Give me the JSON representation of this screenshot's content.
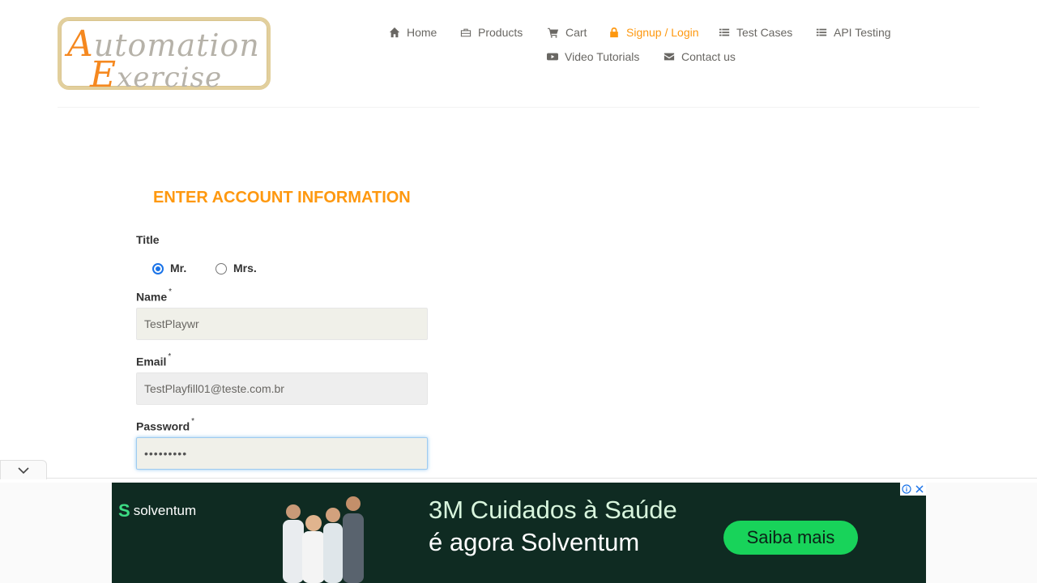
{
  "logo": {
    "line1_cap": "A",
    "line1_rest": "utomation",
    "line2_cap": "E",
    "line2_rest": "xercise"
  },
  "nav": {
    "home": "Home",
    "products": "Products",
    "cart": "Cart",
    "signup_login": "Signup / Login",
    "test_cases": "Test Cases",
    "api_testing": "API Testing",
    "video_tutorials": "Video Tutorials",
    "contact_us": "Contact us"
  },
  "form": {
    "title": "ENTER ACCOUNT INFORMATION",
    "title_label": "Title",
    "title_options": [
      {
        "label": "Mr.",
        "selected": true
      },
      {
        "label": "Mrs.",
        "selected": false
      }
    ],
    "name_label": "Name",
    "name_value": "TestPlaywr",
    "email_label": "Email",
    "email_value": "TestPlayfill01@teste.com.br",
    "password_label": "Password",
    "password_value": "•••••••••",
    "required_mark": "*"
  },
  "ad": {
    "brand": "solventum",
    "headline1": "3M Cuidados à Saúde",
    "headline2": "é agora Solventum",
    "cta": "Saiba mais"
  },
  "colors": {
    "accent": "#fe980f",
    "ad_bg": "#0f2b22",
    "ad_cta": "#18d35a"
  }
}
